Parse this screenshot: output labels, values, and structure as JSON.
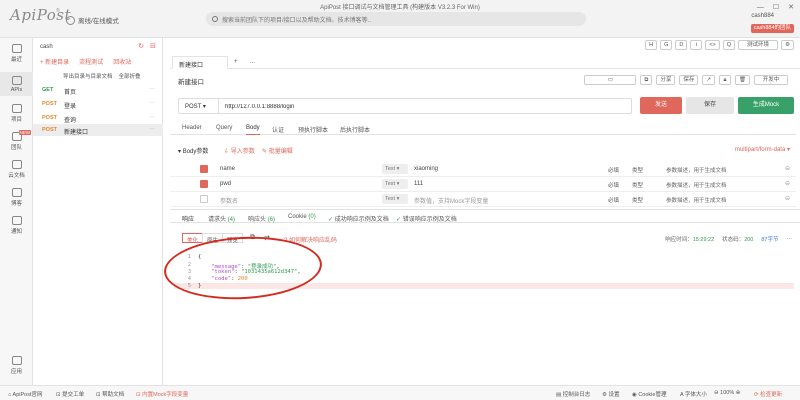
{
  "app": {
    "logo": "ApiPost",
    "logo_mark": "®",
    "mode_toggle": "离线/在线模式",
    "title": "ApiPost 接口调试与文档管理工具 (构建版本 V3.2.3 For Win)",
    "search_placeholder": "搜索当前团队下的项目/接口以及帮助文档、技术博客等..",
    "user_name": "cash884",
    "user_badge": "cash884的团队"
  },
  "toolbar_buttons": [
    "H",
    "G",
    "D",
    "i",
    "<>",
    "Q"
  ],
  "env_select": "测试环境",
  "rail": [
    {
      "label": "最近"
    },
    {
      "label": "APIs"
    },
    {
      "label": "项目"
    },
    {
      "label": "团队",
      "badge": "NEW"
    },
    {
      "label": "云文档"
    },
    {
      "label": "博客"
    },
    {
      "label": "通知"
    },
    {
      "label": "应用"
    }
  ],
  "sidebar": {
    "project": "cash",
    "new_api": "+ 新建目录",
    "flow_test": "流程测试",
    "trash": "回收站",
    "export": "导出目录与目录文档",
    "collapse": "全部折叠",
    "apis": [
      {
        "method": "GET",
        "name": "首页",
        "cls": "m-get"
      },
      {
        "method": "POST",
        "name": "登录",
        "cls": "m-post"
      },
      {
        "method": "POST",
        "name": "查询",
        "cls": "m-post"
      },
      {
        "method": "POST",
        "name": "新建接口",
        "cls": "m-post",
        "active": true
      }
    ]
  },
  "tabs": [
    {
      "label": "新建接口",
      "active": true
    },
    {
      "label": "+"
    },
    {
      "label": "..."
    }
  ],
  "api_name": "新建接口",
  "name_tools": {
    "share": "分享",
    "save": "保存",
    "env": "开发中"
  },
  "request": {
    "method": "POST",
    "url": "http://127.0.0.1:8888/login",
    "send": "发送",
    "save": "保存",
    "mock": "生成Mock"
  },
  "req_tabs": [
    "Header",
    "Query",
    "Body",
    "认证",
    "预执行脚本",
    "后执行脚本"
  ],
  "body": {
    "label": "Body参数",
    "import": "导入参数",
    "bulk": "批量编辑",
    "content_type": "multipart/form-data"
  },
  "params": [
    {
      "checked": true,
      "key": "name",
      "type": "Text",
      "value": "xiaoming",
      "required": "必填",
      "ptype": "类型",
      "desc": "参数描述，用于生成文档"
    },
    {
      "checked": true,
      "key": "pwd",
      "type": "Text",
      "value": "111",
      "required": "必填",
      "ptype": "类型",
      "desc": "参数描述，用于生成文档"
    },
    {
      "checked": false,
      "key": "参数名",
      "type": "Text",
      "value": "参数值，支持Mock字段变量",
      "required": "必填",
      "ptype": "类型",
      "desc": "参数描述，用于生成文档"
    }
  ],
  "response": {
    "tabs": [
      {
        "label": "响应",
        "active": true
      },
      {
        "label": "请求头",
        "count": "(4)"
      },
      {
        "label": "响应头",
        "count": "(6)"
      },
      {
        "label": "Cookie",
        "count": "(0)"
      },
      {
        "label": "成功响应示例及文档",
        "prefix": "✓"
      },
      {
        "label": "错误响应示例及文档",
        "prefix": "✓"
      }
    ],
    "sub_tabs": [
      "美化",
      "原生",
      "预览"
    ],
    "hint": "如何解决响应乱码",
    "time_label": "响应时间：",
    "time": "15:29:22",
    "status_label": "状态码：",
    "status": "200",
    "size": "87字节",
    "lines": [
      {
        "n": "1",
        "text": "{"
      },
      {
        "n": "2",
        "key": "\"message\"",
        "val": "\"登录成功\"",
        "type": "s"
      },
      {
        "n": "3",
        "key": "\"token\"",
        "val": "\"1031435a612d347\"",
        "type": "s"
      },
      {
        "n": "4",
        "key": "\"code\"",
        "val": "200",
        "type": "num"
      },
      {
        "n": "5",
        "text": "}"
      }
    ]
  },
  "status_bar": {
    "official": "ApiPost官网",
    "feedback": "提交工单",
    "help": "帮助文档",
    "mock_notice": "内置Mock字段变量",
    "console": "控制台日志",
    "settings": "设置",
    "cookie": "Cookie管理",
    "font": "字体大小",
    "zoom": "100%",
    "update": "检查更新"
  },
  "colors": {
    "accent": "#e0675c",
    "success": "#38a169",
    "annotation": "#d42b1f"
  }
}
